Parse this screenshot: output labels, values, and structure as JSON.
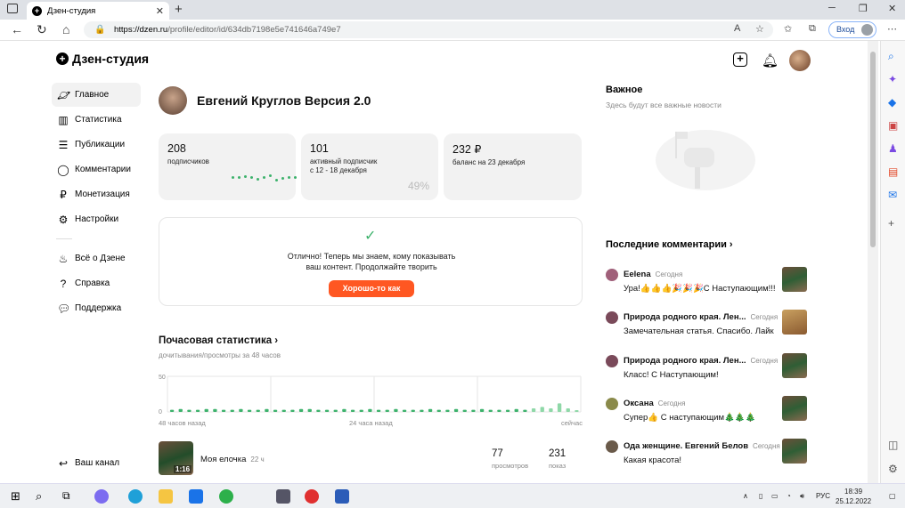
{
  "browser": {
    "tab_title": "Дзен-студия",
    "url_host": "https://dzen.ru",
    "url_path": "/profile/editor/id/634db7198e5e741646a749e7",
    "login_label": "Вход"
  },
  "header": {
    "logo": "Дзен-студия"
  },
  "sidebar": {
    "items": [
      {
        "label": "Главное",
        "icon": "planet-icon"
      },
      {
        "label": "Статистика",
        "icon": "bar-chart-icon"
      },
      {
        "label": "Публикации",
        "icon": "stack-icon"
      },
      {
        "label": "Комментарии",
        "icon": "comment-icon"
      },
      {
        "label": "Монетизация",
        "icon": "ruble-icon"
      },
      {
        "label": "Настройки",
        "icon": "gear-icon"
      }
    ],
    "links": [
      {
        "label": "Всё о Дзене",
        "icon": "flame-icon"
      },
      {
        "label": "Справка",
        "icon": "help-icon"
      },
      {
        "label": "Поддержка",
        "icon": "chat-icon"
      }
    ],
    "channel": "Ваш канал"
  },
  "profile": {
    "name": "Евгений Круглов Версия 2.0"
  },
  "cards": [
    {
      "value": "208",
      "label": "подписчиков"
    },
    {
      "value": "101",
      "label": "активный подписчик",
      "label2": "с 12 - 18 декабря",
      "percent": "49%"
    },
    {
      "value": "232 ₽",
      "label": "баланс на 23 декабря"
    }
  ],
  "notice": {
    "line1": "Отлично! Теперь мы знаем, кому показывать",
    "line2": "ваш контент. Продолжайте творить",
    "button": "Хорошо-то как"
  },
  "hourly": {
    "title": "Почасовая статистика",
    "subtitle": "дочитывания/просмотры за 48 часов",
    "x_left": "48 часов назад",
    "x_mid": "24 часа назад",
    "x_right": "сейчас"
  },
  "chart_data": {
    "type": "bar",
    "title": "Почасовая статистика",
    "ytick_top": "50",
    "ytick_bottom": "0",
    "ylim": [
      0,
      50
    ],
    "values": [
      3,
      4,
      3,
      3,
      4,
      4,
      3,
      3,
      4,
      3,
      3,
      4,
      3,
      3,
      3,
      4,
      4,
      3,
      3,
      3,
      4,
      3,
      3,
      4,
      3,
      3,
      4,
      3,
      3,
      3,
      4,
      3,
      3,
      4,
      3,
      3,
      4,
      3,
      3,
      3,
      4,
      3,
      5,
      7,
      5,
      12,
      5,
      2
    ]
  },
  "publication": {
    "title": "Моя елочка",
    "age": "22 ч",
    "duration": "1:16",
    "views": "77",
    "views_label": "просмотров",
    "impressions": "231",
    "impressions_label": "показ"
  },
  "important": {
    "title": "Важное",
    "subtitle": "Здесь будут все важные новости"
  },
  "comments": {
    "title": "Последние комментарии",
    "items": [
      {
        "author": "Eelena",
        "time": "Сегодня",
        "text": "Ура!👍👍👍🎉🎉🎉С Наступающим!!!"
      },
      {
        "author": "Природа родного края. Лен...",
        "time": "Сегодня",
        "text": "Замечательная статья. Спасибо. Лайк"
      },
      {
        "author": "Природа родного края. Лен...",
        "time": "Сегодня",
        "text": "Класс! С Наступающим!"
      },
      {
        "author": "Оксана",
        "time": "Сегодня",
        "text": "Супер👍 С наступающим🎄🎄🎄"
      },
      {
        "author": "Ода женщине. Евгений Белов",
        "time": "Сегодня",
        "text": "Какая красота!"
      }
    ]
  },
  "taskbar": {
    "lang": "РУС",
    "time": "18:39",
    "date": "25.12.2022"
  }
}
